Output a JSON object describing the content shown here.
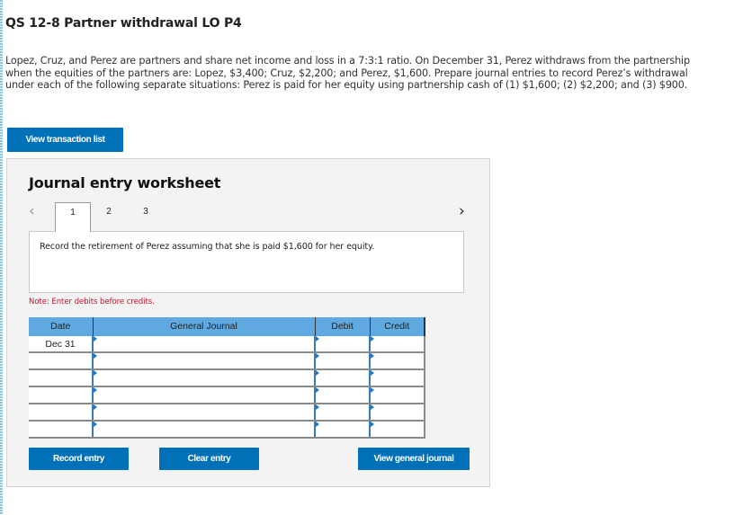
{
  "question": {
    "title": "QS 12-8 Partner withdrawal LO P4",
    "body": "Lopez, Cruz, and Perez are partners and share net income and loss in a 7:3:1 ratio. On December 31, Perez withdraws from the partnership when the equities of the partners are: Lopez, $3,400; Cruz, $2,200; and Perez, $1,600. Prepare journal entries to record Perez’s withdrawal under each of the following separate situations: Perez is paid for her equity using partnership cash of (1) $1,600; (2) $2,200; and (3) $900."
  },
  "buttons": {
    "view_transaction_list": "View transaction list",
    "record_entry": "Record entry",
    "clear_entry": "Clear entry",
    "view_general_journal": "View general journal"
  },
  "worksheet": {
    "title": "Journal entry worksheet",
    "prev_icon": "‹",
    "next_icon": "›",
    "tabs": [
      {
        "label": "1",
        "active": true
      },
      {
        "label": "2",
        "active": false
      },
      {
        "label": "3",
        "active": false
      }
    ],
    "description": "Record the retirement of Perez assuming that she is paid $1,600 for her equity.",
    "note": "Note: Enter debits before credits."
  },
  "journal": {
    "headers": {
      "date": "Date",
      "general_journal": "General Journal",
      "debit": "Debit",
      "credit": "Credit"
    },
    "rows": [
      {
        "date": "Dec 31",
        "account": "",
        "debit": "",
        "credit": ""
      },
      {
        "date": "",
        "account": "",
        "debit": "",
        "credit": ""
      },
      {
        "date": "",
        "account": "",
        "debit": "",
        "credit": ""
      },
      {
        "date": "",
        "account": "",
        "debit": "",
        "credit": ""
      },
      {
        "date": "",
        "account": "",
        "debit": "",
        "credit": ""
      },
      {
        "date": "",
        "account": "",
        "debit": "",
        "credit": ""
      }
    ]
  },
  "colors": {
    "primary_button": "#0071b9",
    "table_header": "#5fa8e0",
    "note_text": "#c8102e",
    "panel_bg": "#f3f3f3"
  }
}
